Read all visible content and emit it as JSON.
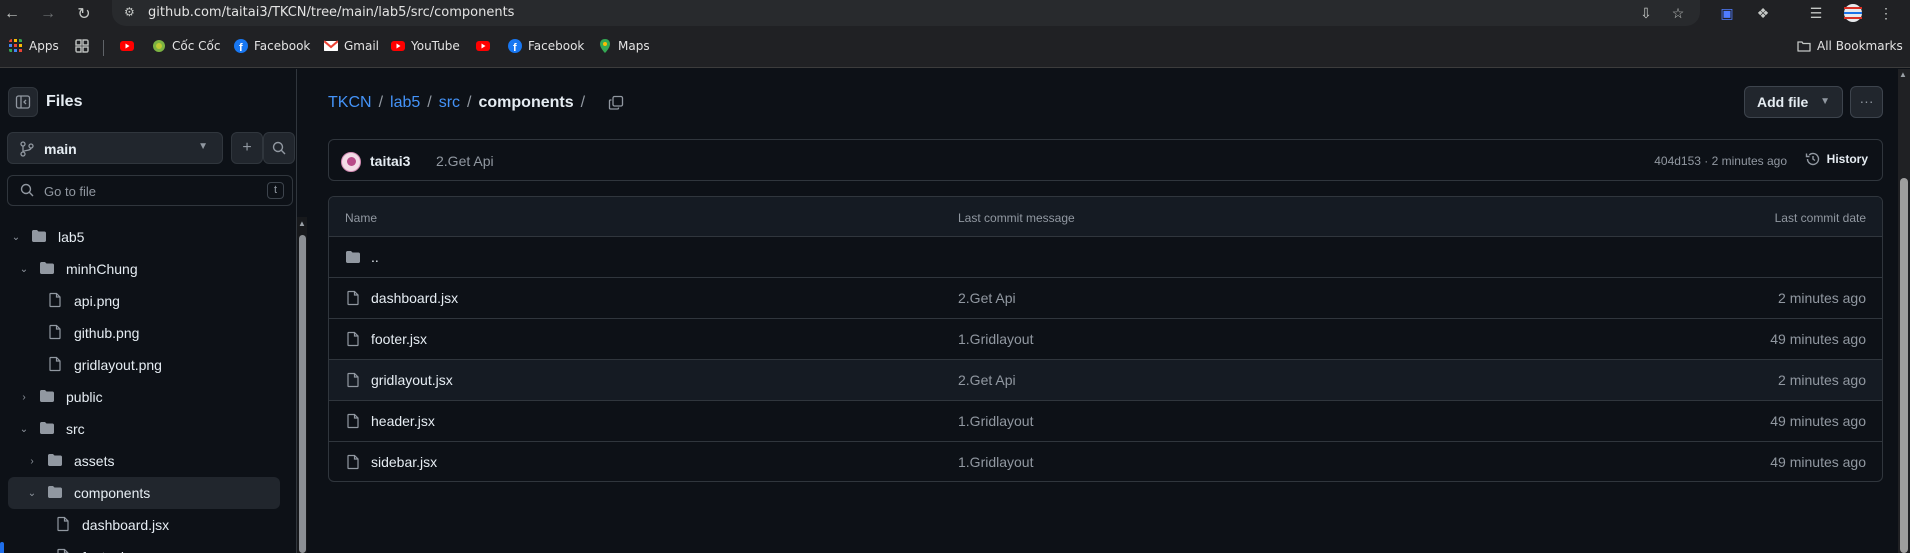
{
  "browser": {
    "url": "github.com/taitai3/TKCN/tree/main/lab5/src/components",
    "bookmarks": [
      {
        "label": "Apps",
        "icon": "apps-grid-icon"
      },
      {
        "label": "",
        "icon": "tab-groups-icon"
      },
      {
        "label": "",
        "icon": "youtube-icon"
      },
      {
        "label": "Cốc Cốc",
        "icon": "coccoc-icon"
      },
      {
        "label": "Facebook",
        "icon": "facebook-icon"
      },
      {
        "label": "Gmail",
        "icon": "gmail-icon"
      },
      {
        "label": "YouTube",
        "icon": "youtube-icon"
      },
      {
        "label": "",
        "icon": "youtube-icon"
      },
      {
        "label": "Facebook",
        "icon": "facebook-icon"
      },
      {
        "label": "Maps",
        "icon": "maps-icon"
      }
    ],
    "all_bookmarks": "All Bookmarks"
  },
  "sidebar": {
    "title": "Files",
    "branch": "main",
    "goto_placeholder": "Go to file",
    "goto_shortcut": "t",
    "tree": [
      {
        "label": "lab5",
        "type": "folder",
        "depth": 0,
        "expanded": true
      },
      {
        "label": "minhChung",
        "type": "folder",
        "depth": 1,
        "expanded": true
      },
      {
        "label": "api.png",
        "type": "file",
        "depth": 2
      },
      {
        "label": "github.png",
        "type": "file",
        "depth": 2
      },
      {
        "label": "gridlayout.png",
        "type": "file",
        "depth": 2
      },
      {
        "label": "public",
        "type": "folder",
        "depth": 1,
        "expanded": false
      },
      {
        "label": "src",
        "type": "folder",
        "depth": 1,
        "expanded": true
      },
      {
        "label": "assets",
        "type": "folder",
        "depth": 2,
        "expanded": false
      },
      {
        "label": "components",
        "type": "folder",
        "depth": 2,
        "expanded": true,
        "selected": true
      },
      {
        "label": "dashboard.jsx",
        "type": "file",
        "depth": 3
      },
      {
        "label": "footer.jsx",
        "type": "file",
        "depth": 3
      }
    ]
  },
  "main": {
    "breadcrumb": {
      "links": [
        "TKCN",
        "lab5",
        "src"
      ],
      "current": "components",
      "separator": "/"
    },
    "add_file_label": "Add file",
    "more_label": "···",
    "commit": {
      "author": "taitai3",
      "message": "2.Get Api",
      "meta": "404d153 · 2 minutes ago",
      "history_label": "History"
    },
    "table": {
      "headers": {
        "name": "Name",
        "message": "Last commit message",
        "date": "Last commit date"
      },
      "parent_dir": "..",
      "rows": [
        {
          "name": "dashboard.jsx",
          "message": "2.Get Api",
          "date": "2 minutes ago"
        },
        {
          "name": "footer.jsx",
          "message": "1.Gridlayout",
          "date": "49 minutes ago"
        },
        {
          "name": "gridlayout.jsx",
          "message": "2.Get Api",
          "date": "2 minutes ago"
        },
        {
          "name": "header.jsx",
          "message": "1.Gridlayout",
          "date": "49 minutes ago"
        },
        {
          "name": "sidebar.jsx",
          "message": "1.Gridlayout",
          "date": "49 minutes ago"
        }
      ]
    }
  },
  "colors": {
    "link": "#4493f8",
    "background": "#0d1117",
    "border": "#30363d",
    "muted": "#9198a1",
    "selection": "#1f6feb"
  }
}
